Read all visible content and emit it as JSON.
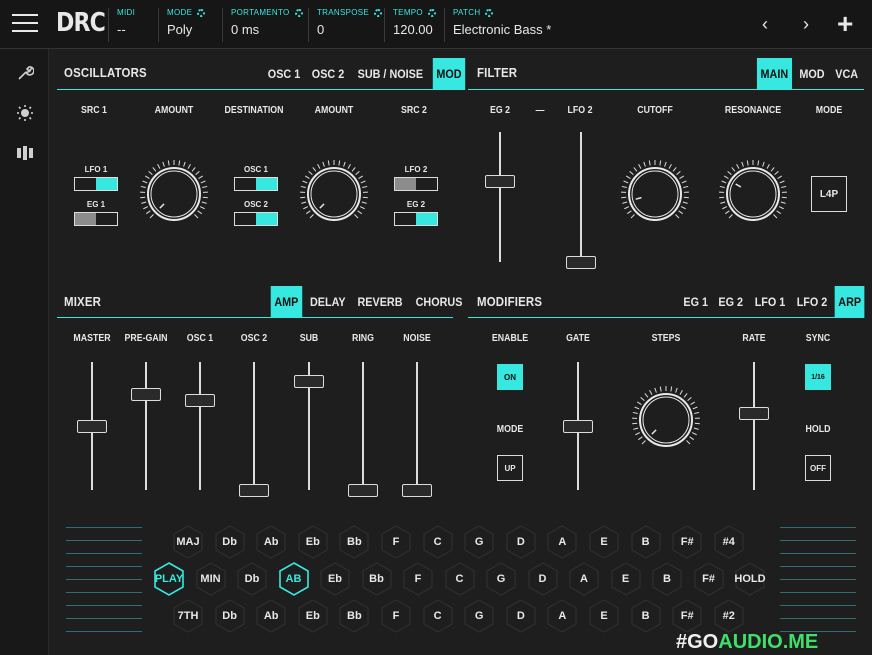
{
  "header": {
    "logo": "DRC",
    "fields": [
      {
        "label": "MIDI",
        "value": "--",
        "gear": false
      },
      {
        "label": "MODE",
        "value": "Poly",
        "gear": true
      },
      {
        "label": "PORTAMENTO",
        "value": "0 ms",
        "gear": true
      },
      {
        "label": "TRANSPOSE",
        "value": "0",
        "gear": true
      },
      {
        "label": "TEMPO",
        "value": "120.00",
        "gear": true
      },
      {
        "label": "PATCH",
        "value": "Electronic Bass *",
        "gear": true
      }
    ],
    "prev": "‹",
    "next": "›",
    "add": "+"
  },
  "sidebar": [
    "wrench-icon",
    "sun-icon",
    "grid-icon"
  ],
  "oscillators": {
    "title": "OSCILLATORS",
    "tabs": [
      "OSC 1",
      "OSC 2",
      "SUB / NOISE",
      "MOD"
    ],
    "active_tab": "MOD",
    "cols": [
      "SRC 1",
      "AMOUNT",
      "DESTINATION",
      "AMOUNT",
      "SRC 2"
    ],
    "src1": [
      {
        "label": "LFO 1",
        "state": "right"
      },
      {
        "label": "EG 1",
        "state": "left-gray"
      }
    ],
    "dest": [
      {
        "label": "OSC 1",
        "state": "right"
      },
      {
        "label": "OSC 2",
        "state": "right"
      }
    ],
    "src2": [
      {
        "label": "LFO 2",
        "state": "left-gray"
      },
      {
        "label": "EG 2",
        "state": "right"
      }
    ]
  },
  "filter": {
    "title": "FILTER",
    "tabs": [
      "MAIN",
      "MOD",
      "VCA"
    ],
    "active_tab": "MAIN",
    "cols": [
      "EG 2",
      "—",
      "LFO 2",
      "CUTOFF",
      "RESONANCE",
      "MODE"
    ],
    "mode_value": "L4P"
  },
  "mixer": {
    "title": "MIXER",
    "tabs": [
      "AMP",
      "DELAY",
      "REVERB",
      "CHORUS"
    ],
    "active_tab": "AMP",
    "cols": [
      "MASTER",
      "PRE-GAIN",
      "OSC 1",
      "OSC 2",
      "SUB",
      "RING",
      "NOISE"
    ],
    "levels": [
      0.5,
      0.75,
      0.7,
      0,
      0.85,
      0,
      0
    ]
  },
  "modifiers": {
    "title": "MODIFIERS",
    "tabs": [
      "EG 1",
      "EG 2",
      "LFO 1",
      "LFO 2",
      "ARP"
    ],
    "active_tab": "ARP",
    "cols": [
      "ENABLE",
      "GATE",
      "STEPS",
      "RATE",
      "SYNC"
    ],
    "enable": "ON",
    "mode_label": "MODE",
    "mode": "UP",
    "sync": "1/16",
    "hold_label": "HOLD",
    "hold": "OFF",
    "gate_level": 0.5,
    "rate_level": 0.6
  },
  "keys": {
    "row1": [
      "MAJ",
      "Db",
      "Ab",
      "Eb",
      "Bb",
      "F",
      "C",
      "G",
      "D",
      "A",
      "E",
      "B",
      "F#",
      "#4"
    ],
    "row2": [
      "PLAY",
      "MIN",
      "Db",
      "AB",
      "Eb",
      "Bb",
      "F",
      "C",
      "G",
      "D",
      "A",
      "E",
      "B",
      "F#",
      "HOLD"
    ],
    "row3": [
      "7TH",
      "Db",
      "Ab",
      "Eb",
      "Bb",
      "F",
      "C",
      "G",
      "D",
      "A",
      "E",
      "B",
      "F#",
      "#2"
    ],
    "active_row2": [
      "PLAY",
      "AB"
    ]
  },
  "watermark": {
    "prefix": "#GO",
    "suffix": "AUDIO.ME"
  },
  "colors": {
    "accent": "#37e8e0",
    "bg": "#1e1e1e"
  }
}
